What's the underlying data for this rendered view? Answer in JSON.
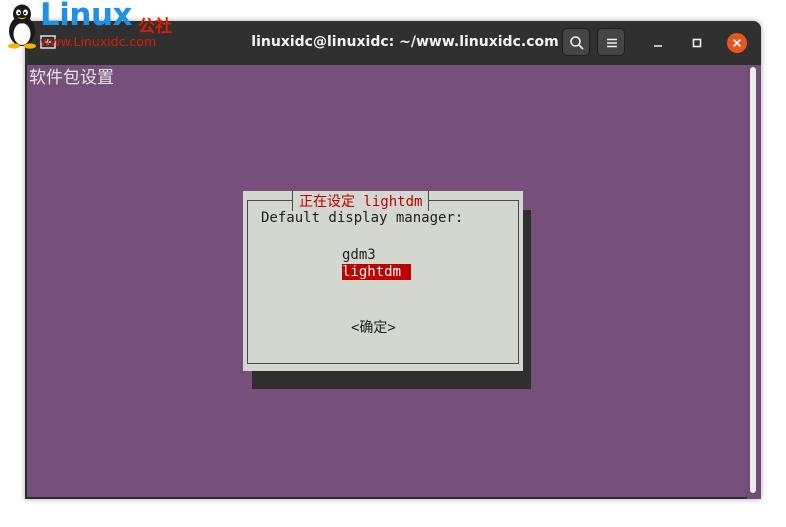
{
  "watermark": {
    "brand": "Linux",
    "brand_cn": "公社",
    "url": "www.Linuxidc.com"
  },
  "window": {
    "title": "linuxidc@linuxidc: ~/www.linuxidc.com"
  },
  "terminal": {
    "backtitle": "软件包设置",
    "dialog": {
      "title": "正在设定 lightdm",
      "prompt": "Default display manager:",
      "options": [
        "gdm3",
        "lightdm"
      ],
      "selected": "lightdm",
      "ok_label": "<确定>"
    }
  },
  "colors": {
    "terminal_bg": "#76507b",
    "dialog_bg": "#d3d7cf",
    "highlight": "#c00000",
    "close_button": "#e95420"
  }
}
